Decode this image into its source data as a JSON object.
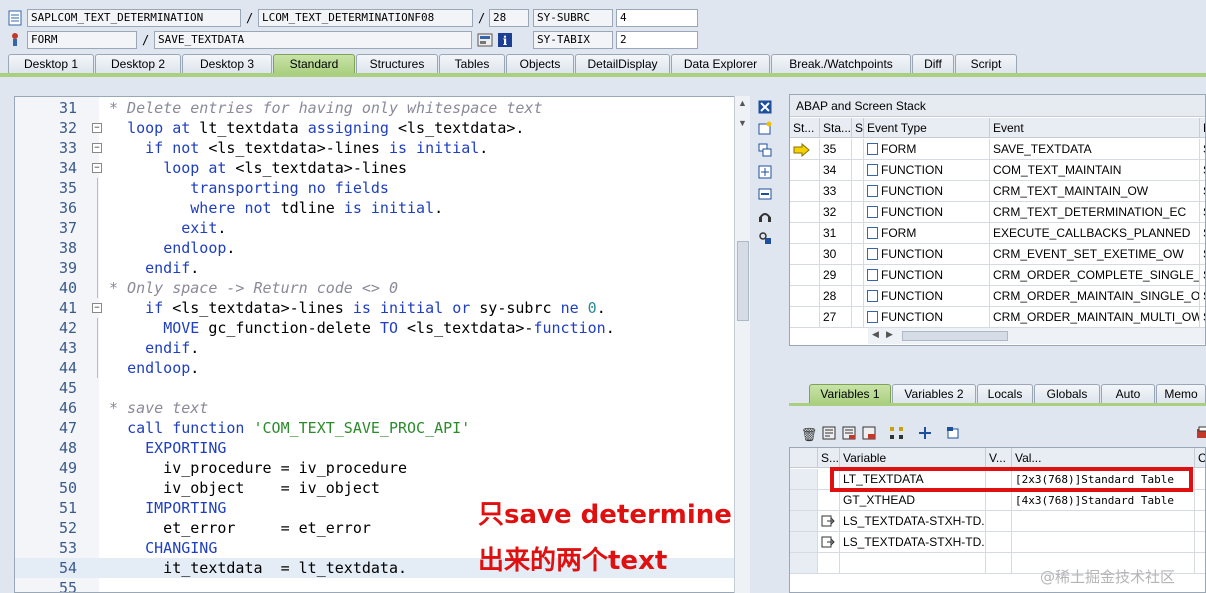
{
  "top": {
    "program": "SAPLCOM_TEXT_DETERMINATION",
    "include": "LCOM_TEXT_DETERMINATIONF08",
    "line": "28",
    "subrc_label": "SY-SUBRC",
    "subrc_value": "4",
    "event_type": "FORM",
    "event": "SAVE_TEXTDATA",
    "tabix_label": "SY-TABIX",
    "tabix_value": "2",
    "slash": "/"
  },
  "tabs": [
    "Desktop 1",
    "Desktop 2",
    "Desktop 3",
    "Standard",
    "Structures",
    "Tables",
    "Objects",
    "DetailDisplay",
    "Data Explorer",
    "Break./Watchpoints",
    "Diff",
    "Script"
  ],
  "active_tab": "Standard",
  "code_lines": [
    {
      "n": "31",
      "t": "* Delete entries for having only whitespace text"
    },
    {
      "n": "32",
      "t": "  loop at lt_textdata assigning <ls_textdata>."
    },
    {
      "n": "33",
      "t": "    if not <ls_textdata>-lines is initial."
    },
    {
      "n": "34",
      "t": "      loop at <ls_textdata>-lines"
    },
    {
      "n": "35",
      "t": "         transporting no fields"
    },
    {
      "n": "36",
      "t": "         where not tdline is initial."
    },
    {
      "n": "37",
      "t": "        exit."
    },
    {
      "n": "38",
      "t": "      endloop."
    },
    {
      "n": "39",
      "t": "    endif."
    },
    {
      "n": "40",
      "t": "* Only space -> Return code <> 0"
    },
    {
      "n": "41",
      "t": "    if <ls_textdata>-lines is initial or sy-subrc ne 0."
    },
    {
      "n": "42",
      "t": "      MOVE gc_function-delete TO <ls_textdata>-function."
    },
    {
      "n": "43",
      "t": "    endif."
    },
    {
      "n": "44",
      "t": "  endloop."
    },
    {
      "n": "45",
      "t": ""
    },
    {
      "n": "46",
      "t": "* save text"
    },
    {
      "n": "47",
      "t": "  call function 'COM_TEXT_SAVE_PROC_API'"
    },
    {
      "n": "48",
      "t": "    EXPORTING"
    },
    {
      "n": "49",
      "t": "      iv_procedure = iv_procedure"
    },
    {
      "n": "50",
      "t": "      iv_object    = iv_object"
    },
    {
      "n": "51",
      "t": "    IMPORTING"
    },
    {
      "n": "52",
      "t": "      et_error     = et_error"
    },
    {
      "n": "53",
      "t": "    CHANGING"
    },
    {
      "n": "54",
      "t": "      it_textdata  = lt_textdata."
    },
    {
      "n": "55",
      "t": ""
    }
  ],
  "annotation": {
    "line1": "只save determine",
    "line2": "出来的两个text"
  },
  "stack": {
    "title": "ABAP and Screen Stack",
    "headers": [
      "St...",
      "Sta...",
      "S...",
      "Event Type",
      "Event",
      "P"
    ],
    "rows": [
      {
        "level": "35",
        "type": "FORM",
        "event": "SAVE_TEXTDATA",
        "p": "S",
        "current": true
      },
      {
        "level": "34",
        "type": "FUNCTION",
        "event": "COM_TEXT_MAINTAIN",
        "p": "S"
      },
      {
        "level": "33",
        "type": "FUNCTION",
        "event": "CRM_TEXT_MAINTAIN_OW",
        "p": "S"
      },
      {
        "level": "32",
        "type": "FUNCTION",
        "event": "CRM_TEXT_DETERMINATION_EC",
        "p": "S"
      },
      {
        "level": "31",
        "type": "FORM",
        "event": "EXECUTE_CALLBACKS_PLANNED",
        "p": "S"
      },
      {
        "level": "30",
        "type": "FUNCTION",
        "event": "CRM_EVENT_SET_EXETIME_OW",
        "p": "S"
      },
      {
        "level": "29",
        "type": "FUNCTION",
        "event": "CRM_ORDER_COMPLETE_SINGLE_O...",
        "p": "S"
      },
      {
        "level": "28",
        "type": "FUNCTION",
        "event": "CRM_ORDER_MAINTAIN_SINGLE_OW",
        "p": "S"
      },
      {
        "level": "27",
        "type": "FUNCTION",
        "event": "CRM_ORDER_MAINTAIN_MULTI_OW",
        "p": "S"
      }
    ]
  },
  "var_tabs": [
    "Variables 1",
    "Variables 2",
    "Locals",
    "Globals",
    "Auto",
    "Memo"
  ],
  "active_var_tab": "Variables 1",
  "variables": {
    "headers": [
      "S...",
      "Variable",
      "V...",
      "Val...",
      "C..."
    ],
    "rows": [
      {
        "name": "LT_TEXTDATA",
        "val": "[2x3(768)]Standard Table",
        "highlight": true
      },
      {
        "name": "GT_XTHEAD",
        "val": "[4x3(768)]Standard Table"
      },
      {
        "name": "LS_TEXTDATA-STXH-TD...",
        "val": ""
      },
      {
        "name": "LS_TEXTDATA-STXH-TD...",
        "val": ""
      },
      {
        "name": "",
        "val": ""
      }
    ]
  },
  "watermark": "@稀土掘金技术社区"
}
